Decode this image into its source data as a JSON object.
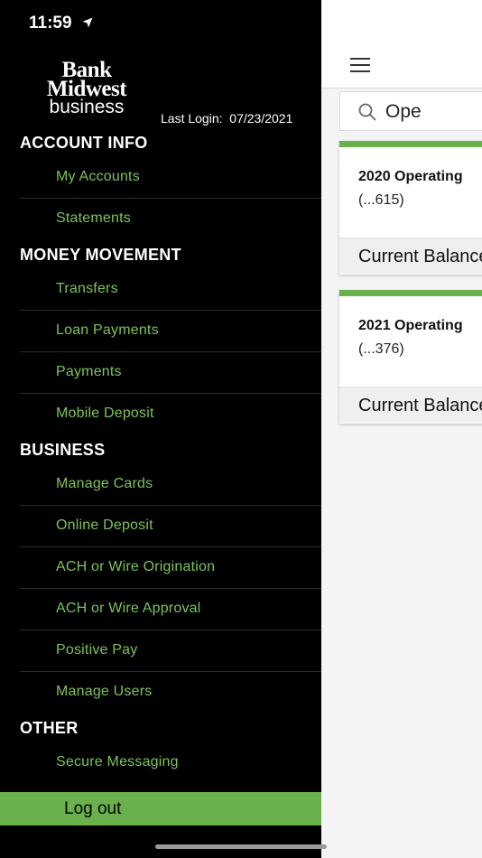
{
  "status_bar": {
    "time": "11:59"
  },
  "logo": {
    "line1": "Bank",
    "line2": "Midwest",
    "line3": "business"
  },
  "last_login": {
    "label": "Last Login:",
    "date": "07/23/2021"
  },
  "sections": {
    "account_info": {
      "title": "ACCOUNT INFO",
      "items": [
        "My Accounts",
        "Statements"
      ]
    },
    "money_movement": {
      "title": "MONEY MOVEMENT",
      "items": [
        "Transfers",
        "Loan Payments",
        "Payments",
        "Mobile Deposit"
      ]
    },
    "business": {
      "title": "BUSINESS",
      "items": [
        "Manage Cards",
        "Online Deposit",
        "ACH or Wire Origination",
        "ACH or Wire Approval",
        "Positive Pay",
        "Manage Users"
      ]
    },
    "other": {
      "title": "OTHER",
      "items": [
        "Secure Messaging"
      ]
    }
  },
  "logout_label": "Log out",
  "search": {
    "value": "Ope"
  },
  "accounts": [
    {
      "name": "2020 Operating",
      "number": "(...615)",
      "balance_label": "Current Balance"
    },
    {
      "name": "2021 Operating",
      "number": "(...376)",
      "balance_label": "Current Balance"
    }
  ],
  "colors": {
    "accent": "#6ab04c",
    "menu_text": "#7cc35a",
    "drawer_bg": "#000000"
  }
}
